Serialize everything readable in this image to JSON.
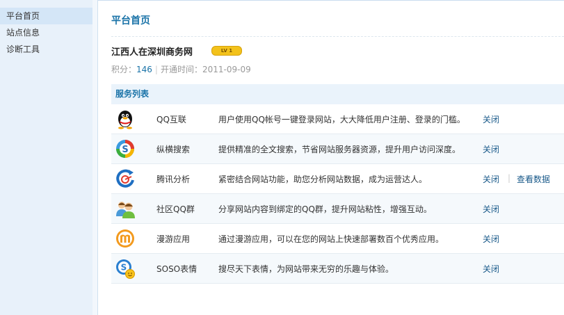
{
  "sidebar": {
    "items": [
      {
        "label": "平台首页",
        "active": true
      },
      {
        "label": "站点信息",
        "active": false
      },
      {
        "label": "诊断工具",
        "active": false
      }
    ]
  },
  "page_title": "平台首页",
  "site": {
    "name": "江西人在深圳商务网",
    "level_badge": "LV 1",
    "points_label": "积分：",
    "points": "146",
    "open_time_label": "开通时间：",
    "open_time": "2011-09-09"
  },
  "services": {
    "header": "服务列表",
    "rows": [
      {
        "icon": "qq-penguin-icon",
        "name": "QQ互联",
        "desc": "用户使用QQ帐号一键登录网站，大大降低用户注册、登录的门槛。",
        "action": "关闭",
        "action2": ""
      },
      {
        "icon": "zongheng-search-icon",
        "name": "纵横搜索",
        "desc": "提供精准的全文搜索，节省网站服务器资源，提升用户访问深度。",
        "action": "关闭",
        "action2": ""
      },
      {
        "icon": "tencent-analytics-icon",
        "name": "腾讯分析",
        "desc": "紧密结合网站功能，助您分析网站数据，成为运营达人。",
        "action": "关闭",
        "action2": "查看数据"
      },
      {
        "icon": "community-group-icon",
        "name": "社区QQ群",
        "desc": "分享网站内容到绑定的QQ群，提升网站粘性，增强互动。",
        "action": "关闭",
        "action2": ""
      },
      {
        "icon": "manyou-app-icon",
        "name": "漫游应用",
        "desc": "通过漫游应用，可以在您的网站上快速部署数百个优秀应用。",
        "action": "关闭",
        "action2": ""
      },
      {
        "icon": "soso-emoticon-icon",
        "name": "SOSO表情",
        "desc": "搜尽天下表情，为网站带来无穷的乐趣与体验。",
        "action": "关闭",
        "action2": ""
      }
    ]
  },
  "colors": {
    "accent": "#1a73a8",
    "sidebar_bg": "#e8f1fa",
    "header_bg": "#eaf3fb"
  }
}
